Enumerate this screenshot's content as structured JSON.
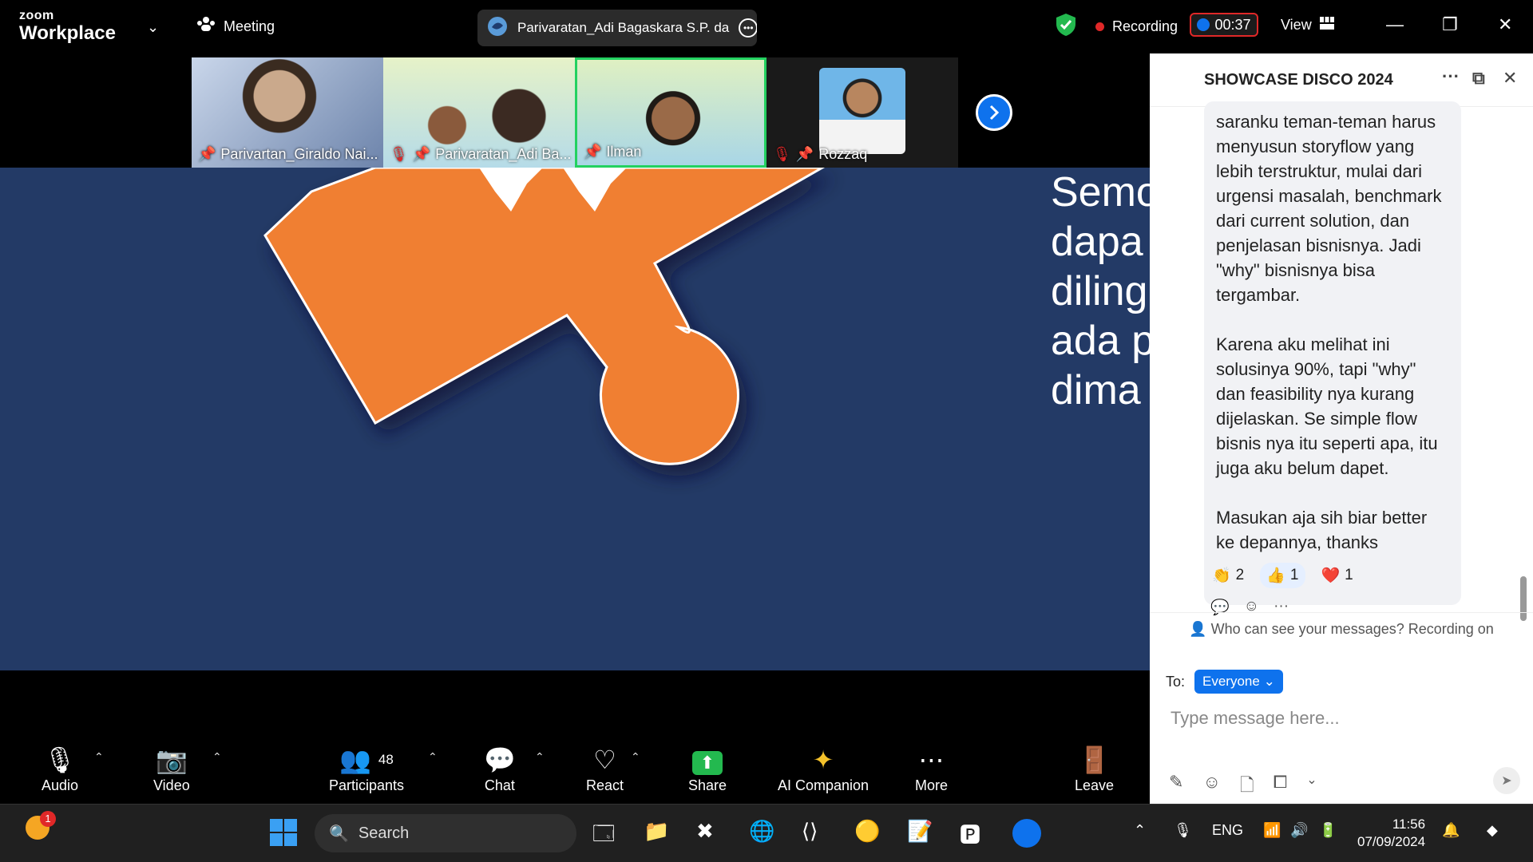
{
  "topbar": {
    "brand_line1": "zoom",
    "brand_line2": "Workplace",
    "meeting_label": "Meeting",
    "share_title": "Parivaratan_Adi Bagaskara S.P. da",
    "recording_label": "Recording",
    "timer": "00:37",
    "view_label": "View"
  },
  "participants_strip": [
    {
      "name": "Parivartan_Giraldo Nai..."
    },
    {
      "name": "Parivaratan_Adi Ba..."
    },
    {
      "name": "Ilman"
    },
    {
      "name": "Rozzaq"
    }
  ],
  "slide": {
    "lines": [
      "Semo",
      "dapa",
      "diling",
      "ada p",
      "dima"
    ]
  },
  "chat": {
    "title": "SHOWCASE DISCO 2024",
    "message": "saranku teman-teman harus\nmenyusun storyflow yang\nlebih terstruktur, mulai dari\nurgensi masalah, benchmark\ndari current solution, dan\npenjelasan bisnisnya. Jadi\n\"why\" bisnisnya bisa\ntergambar.\n\nKarena aku melihat ini\nsolusinya 90%, tapi \"why\"\ndan feasibility nya kurang\ndijelaskan. Se simple flow\nbisnis nya itu seperti apa, itu\njuga aku belum dapet.\n\nMasukan aja sih biar better\nke depannya, thanks",
    "reactions": [
      {
        "emoji": "👏",
        "count": "2"
      },
      {
        "emoji": "👍",
        "count": "1"
      },
      {
        "emoji": "❤️",
        "count": "1"
      }
    ],
    "notice": "Who can see your messages? Recording on",
    "to_label": "To:",
    "to_value": "Everyone",
    "placeholder": "Type message here..."
  },
  "toolbar": {
    "audio": "Audio",
    "video": "Video",
    "participants": "Participants",
    "participants_count": "48",
    "chat": "Chat",
    "react": "React",
    "share": "Share",
    "ai": "AI Companion",
    "more": "More",
    "leave": "Leave"
  },
  "taskbar": {
    "search": "Search",
    "lang": "ENG",
    "time": "11:56",
    "date": "07/09/2024",
    "notif_count": "1"
  },
  "colors": {
    "accent": "#0e72ed",
    "slide_bg": "#233a66",
    "puzzle": "#f07f32",
    "record": "#e02828",
    "active_border": "#23d160"
  }
}
